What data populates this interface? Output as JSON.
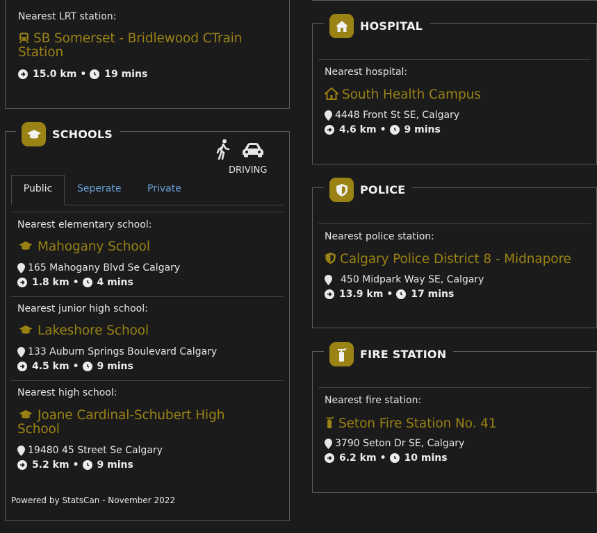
{
  "lrt": {
    "label": "Nearest LRT station:",
    "name_line1": "SB Somerset - Bridlewood CTrain",
    "name_line2": "Station",
    "distance": "15.0 km",
    "time": "19 mins"
  },
  "schools": {
    "title": "SCHOOLS",
    "mode_label": "DRIVING",
    "tabs": [
      "Public",
      "Seperate",
      "Private"
    ],
    "items": [
      {
        "label": "Nearest elementary school:",
        "name_line1": "Mahogany School",
        "name_line2": "",
        "address": "165 Mahogany Blvd Se Calgary",
        "distance": "1.8 km",
        "time": "4 mins"
      },
      {
        "label": "Nearest junior high school:",
        "name_line1": "Lakeshore School",
        "name_line2": "",
        "address": "133 Auburn Springs Boulevard Calgary",
        "distance": "4.5 km",
        "time": "9 mins"
      },
      {
        "label": "Nearest high school:",
        "name_line1": "Joane Cardinal-Schubert High",
        "name_line2": "School",
        "address": "19480 45 Street Se Calgary",
        "distance": "5.2 km",
        "time": "9 mins"
      }
    ],
    "footer": "Powered by StatsCan - November 2022"
  },
  "hospital": {
    "title": "HOSPITAL",
    "label": "Nearest hospital:",
    "name": "South Health Campus",
    "address": "4448 Front St SE, Calgary",
    "distance": "4.6 km",
    "time": "9 mins"
  },
  "police": {
    "title": "POLICE",
    "label": "Nearest police station:",
    "name": "Calgary Police District 8 - Midnapore",
    "address": "450 Midpark Way SE, Calgary",
    "distance": "13.9 km",
    "time": "17 mins"
  },
  "fire": {
    "title": "FIRE STATION",
    "label": "Nearest fire station:",
    "name": "Seton Fire Station No. 41",
    "address": "3790 Seton Dr SE, Calgary",
    "distance": "6.2 km",
    "time": "10 mins"
  },
  "colors": {
    "accent": "#9a8214",
    "background": "#1b1b1b",
    "border": "#5a5a5a",
    "tab_link": "#6aa0d8"
  },
  "icons": {
    "lrt": "train-icon",
    "school": "graduation-cap-icon",
    "hospital": "house-icon",
    "police": "shield-icon",
    "fire": "fire-extinguisher-icon",
    "location": "map-pin-icon",
    "distance": "arrow-right-circle-icon",
    "time": "clock-icon",
    "walking": "walking-person-icon",
    "driving": "car-icon"
  }
}
